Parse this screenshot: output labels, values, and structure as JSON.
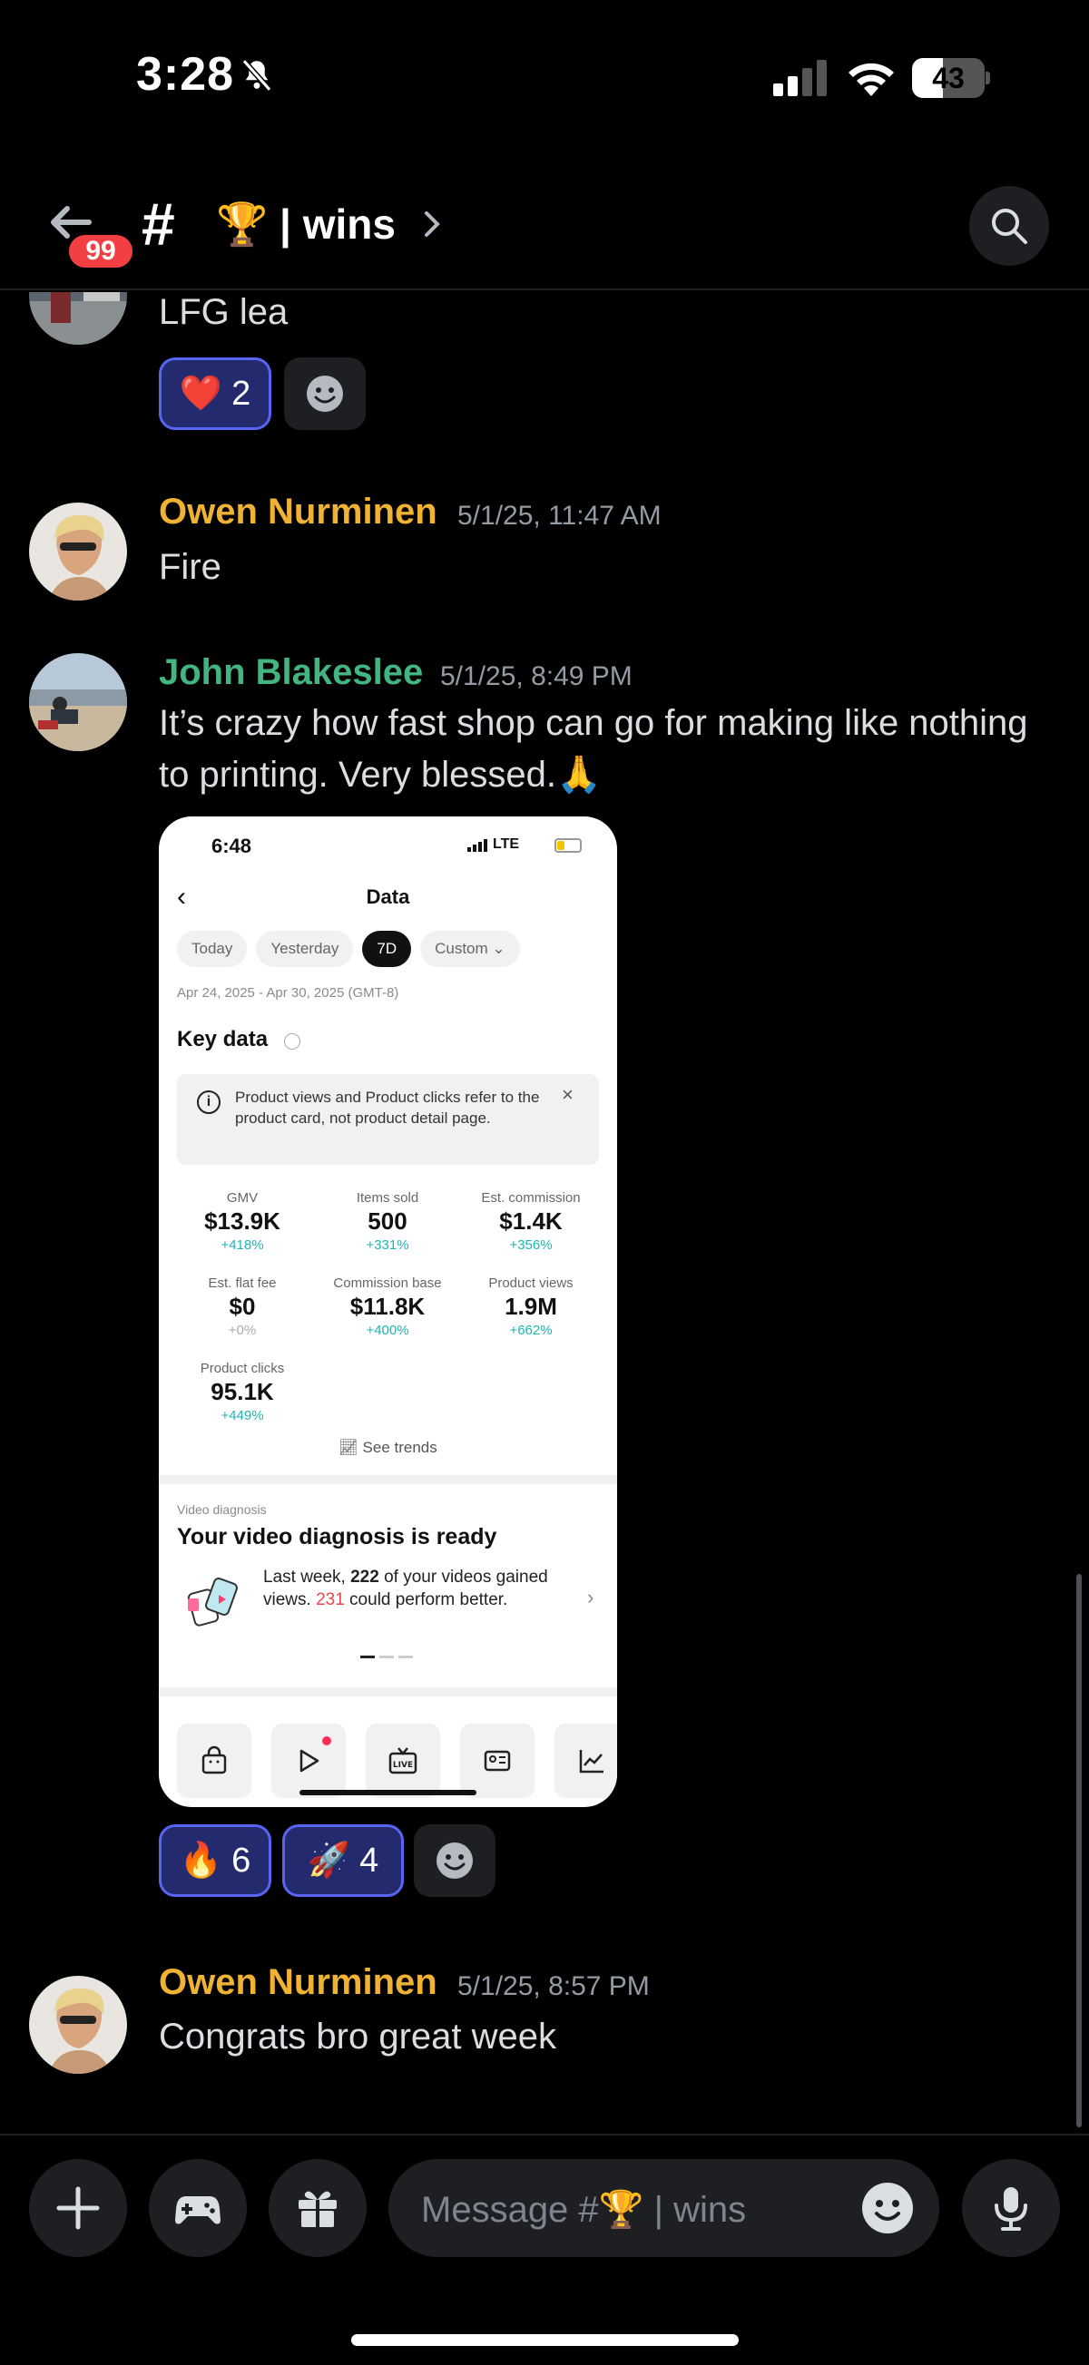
{
  "status": {
    "time": "3:28",
    "battery": "43",
    "battery_level": 0.43
  },
  "header": {
    "unread_badge": "99",
    "channel_prefix": "#",
    "channel_name": "🏆 | wins"
  },
  "messages": [
    {
      "continuation_text": "LFG lea",
      "reactions": [
        {
          "emoji": "❤️",
          "count": "2"
        }
      ]
    },
    {
      "author": "Owen Nurminen",
      "author_color": "#f0b232",
      "timestamp": "5/1/25, 11:47 AM",
      "text": "Fire"
    },
    {
      "author": "John Blakeslee",
      "author_color": "#43b581",
      "timestamp": "5/1/25, 8:49 PM",
      "text": "It’s crazy how fast shop can go for making like nothing to printing. Very blessed.🙏",
      "reactions": [
        {
          "emoji": "🔥",
          "count": "6"
        },
        {
          "emoji": "🚀",
          "count": "4"
        }
      ]
    },
    {
      "author": "Owen Nurminen",
      "author_color": "#f0b232",
      "timestamp": "5/1/25, 8:57 PM",
      "text": "Congrats bro great week"
    }
  ],
  "screenshot": {
    "time": "6:48",
    "network": "LTE",
    "title": "Data",
    "chips": [
      "Today",
      "Yesterday",
      "7D",
      "Custom"
    ],
    "active_chip": "7D",
    "date_range": "Apr 24, 2025 - Apr 30, 2025 (GMT-8)",
    "key_data_title": "Key data",
    "notice": "Product views and Product clicks refer to the product card, not product detail page.",
    "metrics": [
      {
        "label": "GMV",
        "value": "$13.9K",
        "delta": "+418%"
      },
      {
        "label": "Items sold",
        "value": "500",
        "delta": "+331%"
      },
      {
        "label": "Est. commission",
        "value": "$1.4K",
        "delta": "+356%"
      },
      {
        "label": "Est. flat fee",
        "value": "$0",
        "delta": "+0%"
      },
      {
        "label": "Commission base",
        "value": "$11.8K",
        "delta": "+400%"
      },
      {
        "label": "Product views",
        "value": "1.9M",
        "delta": "+662%"
      },
      {
        "label": "Product clicks",
        "value": "95.1K",
        "delta": "+449%"
      }
    ],
    "see_trends": "See trends",
    "video_diagnosis": {
      "label": "Video diagnosis",
      "title": "Your video diagnosis is ready",
      "text_1": "Last week, ",
      "num_gained": "222",
      "text_2": " of your videos gained views. ",
      "num_better": "231",
      "text_3": " could perform better."
    }
  },
  "composer": {
    "placeholder": "Message #🏆 | wins"
  }
}
